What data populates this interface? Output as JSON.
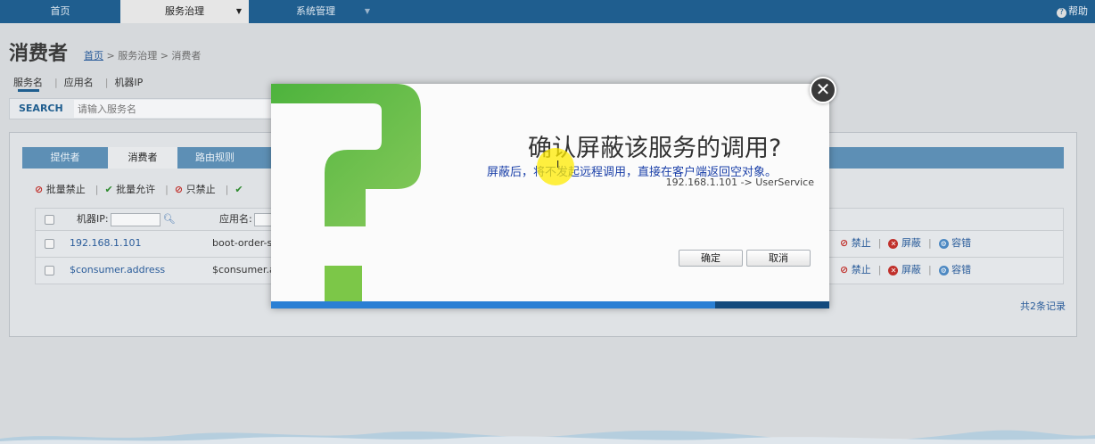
{
  "topbar": {
    "tabs": [
      {
        "label": "首页"
      },
      {
        "label": "服务治理"
      },
      {
        "label": "系统管理"
      }
    ],
    "help_label": "帮助"
  },
  "page": {
    "title": "消费者",
    "breadcrumb": {
      "home": "首页",
      "rest": " > 服务治理 > 消费者"
    },
    "subtabs": [
      "服务名",
      "应用名",
      "机器IP"
    ],
    "search": {
      "label": "SEARCH",
      "placeholder": "请输入服务名"
    }
  },
  "panel": {
    "tabs": [
      "提供者",
      "消费者",
      "路由规则"
    ],
    "toolbar": {
      "batch_ban": "批量禁止",
      "batch_allow": "批量允许",
      "only_ban": "只禁止"
    },
    "columns": {
      "ip": "机器IP:",
      "app": "应用名:"
    },
    "rows": [
      {
        "ip": "192.168.1.101",
        "app": "boot-order-ser",
        "actions": [
          "禁止",
          "屏蔽",
          "容错"
        ]
      },
      {
        "ip": "$consumer.address",
        "app": "$consumer.ap",
        "actions": [
          "禁止",
          "屏蔽",
          "容错"
        ]
      }
    ],
    "total": "共2条记录"
  },
  "dialog": {
    "title": "确认屏蔽该服务的调用?",
    "message": "屏蔽后，将不发起远程调用，直接在客户端返回空对象。",
    "detail": "192.168.1.101 -> UserService",
    "ok_label": "确定",
    "cancel_label": "取消",
    "close_symbol": "✕"
  },
  "colors": {
    "nav": "#1f5e8f",
    "accent_blue": "#1a3fa8",
    "qmark_green": "#6cc04a"
  }
}
